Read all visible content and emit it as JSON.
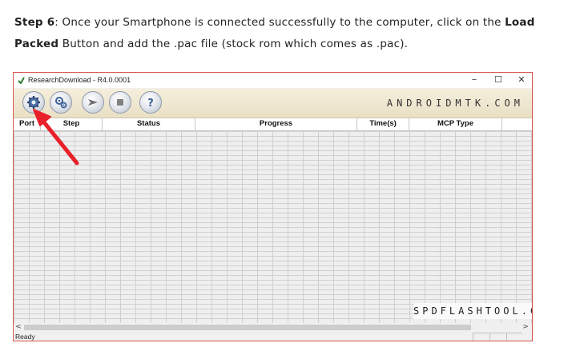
{
  "instructions": {
    "step_label": "Step 6",
    "line1_text": ": Once your Smartphone is connected successfully to the computer, click on the ",
    "load_bold": "Load",
    "packed_bold": "Packed",
    "line2_text": " Button and add the .pac file (stock rom which comes as .pac)."
  },
  "window": {
    "title": "ResearchDownload - R4.0.0001",
    "controls": {
      "minimize": "−",
      "maximize": "☐",
      "close": "✕"
    }
  },
  "toolbar": {
    "buttons": [
      {
        "icon": "gear-icon"
      },
      {
        "icon": "settings-icon"
      },
      {
        "icon": "play-icon"
      },
      {
        "icon": "stop-icon"
      },
      {
        "icon": "help-icon"
      }
    ],
    "brand": "ANDROIDMTK.COM"
  },
  "grid": {
    "columns": [
      "Port",
      "Step",
      "Status",
      "Progress",
      "Time(s)",
      "MCP Type"
    ]
  },
  "watermark": "SPDFLASHTOOL.COM",
  "scrollbar": {
    "left_arrow": "<",
    "right_arrow": ">"
  },
  "status_bar": {
    "text": "Ready"
  },
  "colors": {
    "annotation_arrow": "#e8202a",
    "window_border": "#d9534f",
    "toolbar_bg": "#efe7cf"
  }
}
